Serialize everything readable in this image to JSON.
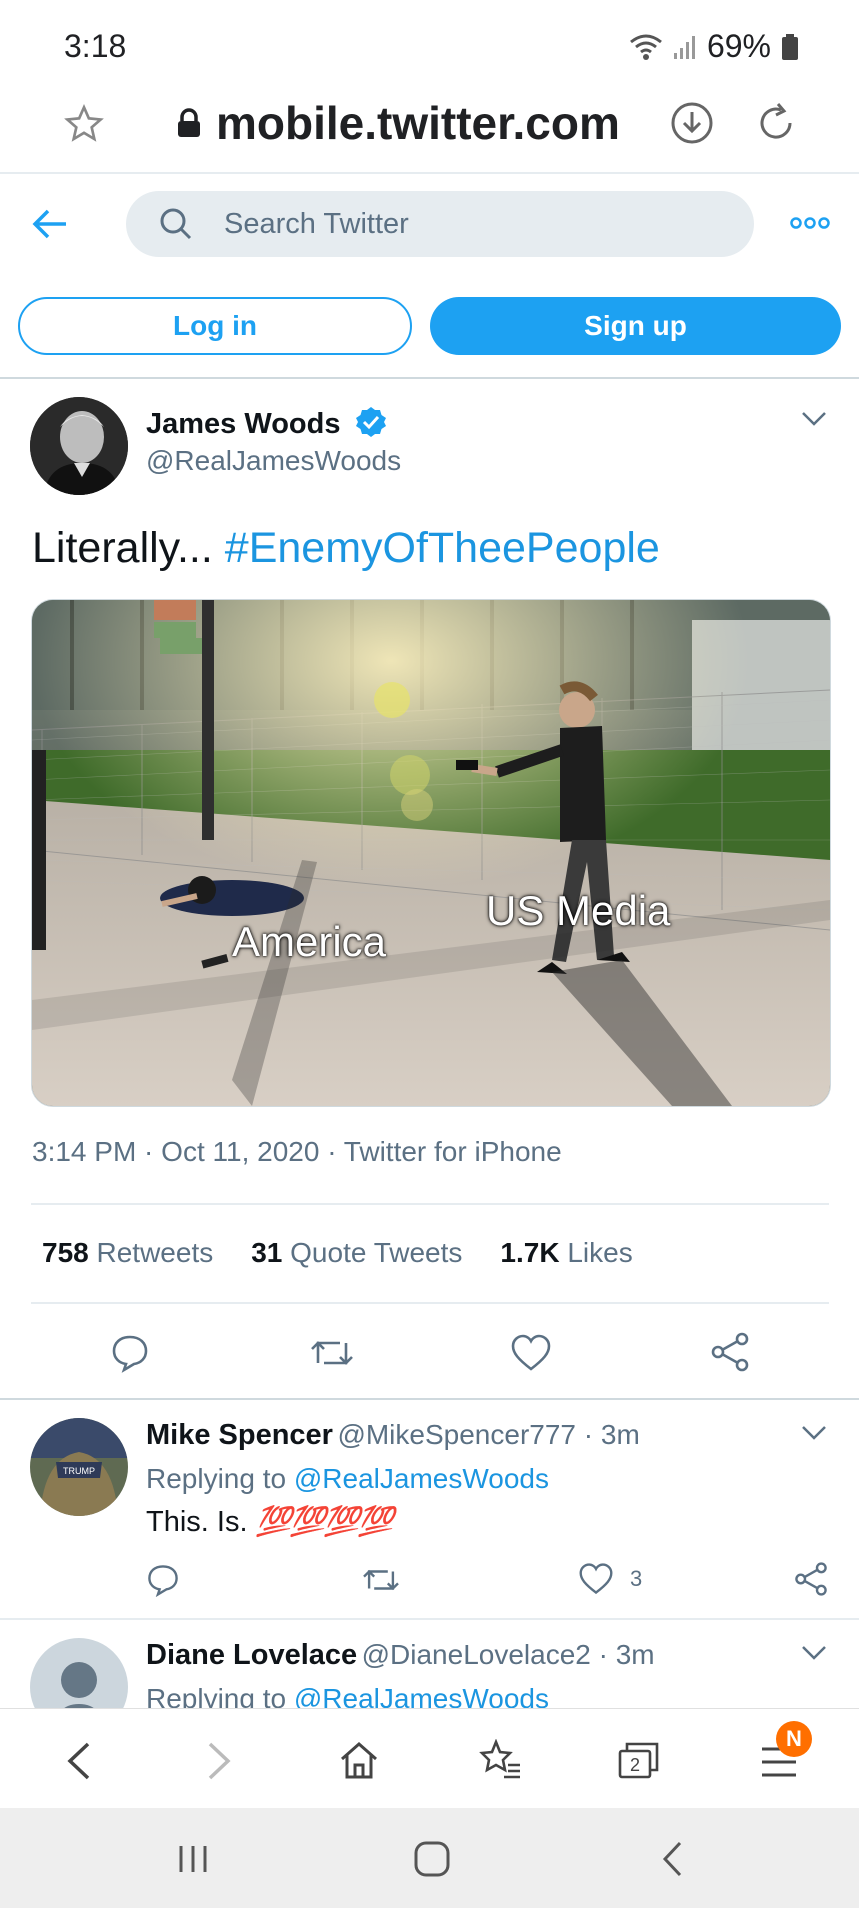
{
  "status_bar": {
    "time": "3:18",
    "battery": "69%"
  },
  "browser": {
    "url": "mobile.twitter.com"
  },
  "header": {
    "search_placeholder": "Search Twitter"
  },
  "auth": {
    "login_label": "Log in",
    "signup_label": "Sign up"
  },
  "tweet": {
    "author_name": "James Woods",
    "author_handle": "@RealJamesWoods",
    "text_prefix": "Literally...",
    "hashtag": "#EnemyOfTheePeople",
    "image_labels": {
      "left": "America",
      "right": "US Media"
    },
    "meta": "3:14 PM · Oct 11, 2020 · Twitter for iPhone",
    "stats": [
      {
        "value": "758",
        "label": "Retweets"
      },
      {
        "value": "31",
        "label": "Quote Tweets"
      },
      {
        "value": "1.7K",
        "label": "Likes"
      }
    ]
  },
  "replies": [
    {
      "name": "Mike Spencer",
      "handle_time": "@MikeSpencer777 · 3m",
      "replying_prefix": "Replying to",
      "replying_to": "@RealJamesWoods",
      "text": "This. Is.",
      "emoji": "💯💯💯💯",
      "likes": "3"
    },
    {
      "name": "Diane Lovelace",
      "handle_time": "@DianeLovelace2 · 3m",
      "replying_prefix": "Replying to",
      "replying_to": "@RealJamesWoods"
    }
  ],
  "browser_nav": {
    "tabs_count": "2",
    "menu_badge": "N"
  },
  "colors": {
    "accent": "#1da1f2",
    "link": "#1b95e0",
    "muted": "#5b7083",
    "badge": "#ff6f00"
  }
}
